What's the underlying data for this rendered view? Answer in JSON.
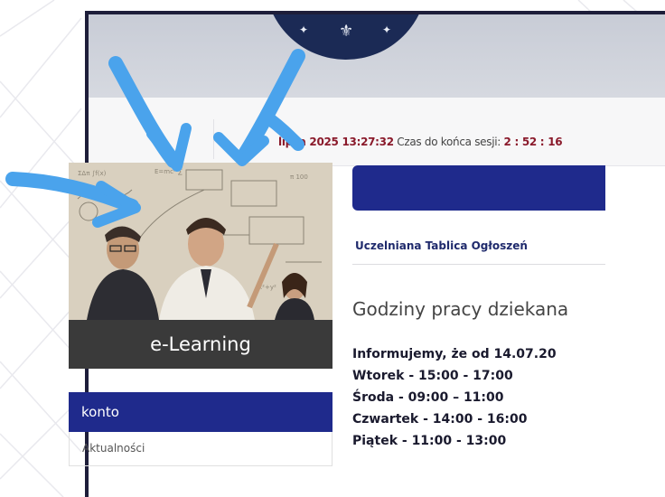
{
  "session": {
    "date_prefix": "lipca",
    "date_value": "lipca 2025 13:27:32",
    "countdown_label": "Czas do końca sesji:",
    "countdown_value": "2 : 52 : 16"
  },
  "elearning": {
    "label": "e-Learning"
  },
  "sidebar": {
    "account_title": "konto",
    "items": [
      {
        "label": "Aktualności"
      }
    ]
  },
  "main": {
    "tab_label": "Uczelniana Tablica Ogłoszeń",
    "announcement_title": "Godziny pracy dziekana",
    "lines": [
      "Informujemy, że od 14.07.20",
      "Wtorek - 15:00 - 17:00",
      "Środa - 09:00 – 11:00",
      "Czwartek - 14:00 - 16:00",
      "Piątek - 11:00 - 13:00"
    ]
  },
  "colors": {
    "primary": "#1f2a8c",
    "accent": "#8a1a2b",
    "annotation_arrow": "#4aa3ec",
    "frame": "#1e1e3a"
  }
}
